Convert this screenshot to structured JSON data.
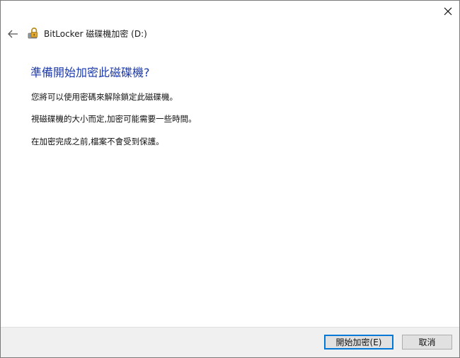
{
  "window": {
    "title": "BitLocker 磁碟機加密 (D:)"
  },
  "icons": {
    "close": "close-icon",
    "back": "back-arrow-icon",
    "app": "bitlocker-drive-icon"
  },
  "content": {
    "heading": "準備開始加密此磁碟機?",
    "paragraphs": [
      "您將可以使用密碼來解除鎖定此磁碟機。",
      "視磁碟機的大小而定,加密可能需要一些時間。",
      "在加密完成之前,檔案不會受到保護。"
    ]
  },
  "buttons": {
    "start_label": "開始加密(E)",
    "cancel_label": "取消"
  },
  "colors": {
    "heading": "#1c3aa9",
    "focus_border": "#0078d7"
  }
}
